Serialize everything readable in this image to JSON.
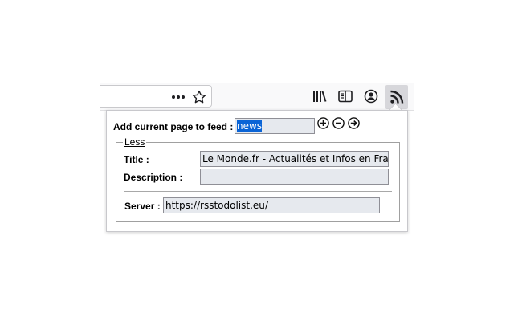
{
  "toolbar": {
    "overflow_icon": "ellipsis-icon",
    "bookmark_icon": "star-icon",
    "library_icon": "library-icon",
    "sidebar_icon": "sidebar-icon",
    "account_icon": "account-icon",
    "rss_icon": "rss-icon"
  },
  "panel": {
    "add_label": "Add current page to feed :",
    "feed_value": "news",
    "add_icon": "plus-circle-icon",
    "remove_icon": "minus-circle-icon",
    "go_icon": "arrow-right-circle-icon",
    "less_legend": "Less",
    "title_label": "Title :",
    "title_value": "Le Monde.fr - Actualités et Infos en Fran",
    "description_label": "Description :",
    "description_value": "",
    "server_label": "Server :",
    "server_value": "https://rsstodolist.eu/"
  },
  "colors": {
    "selection": "#0a64d6",
    "field_bg": "#e6e9ee",
    "active_button_bg": "#d7d7db"
  }
}
